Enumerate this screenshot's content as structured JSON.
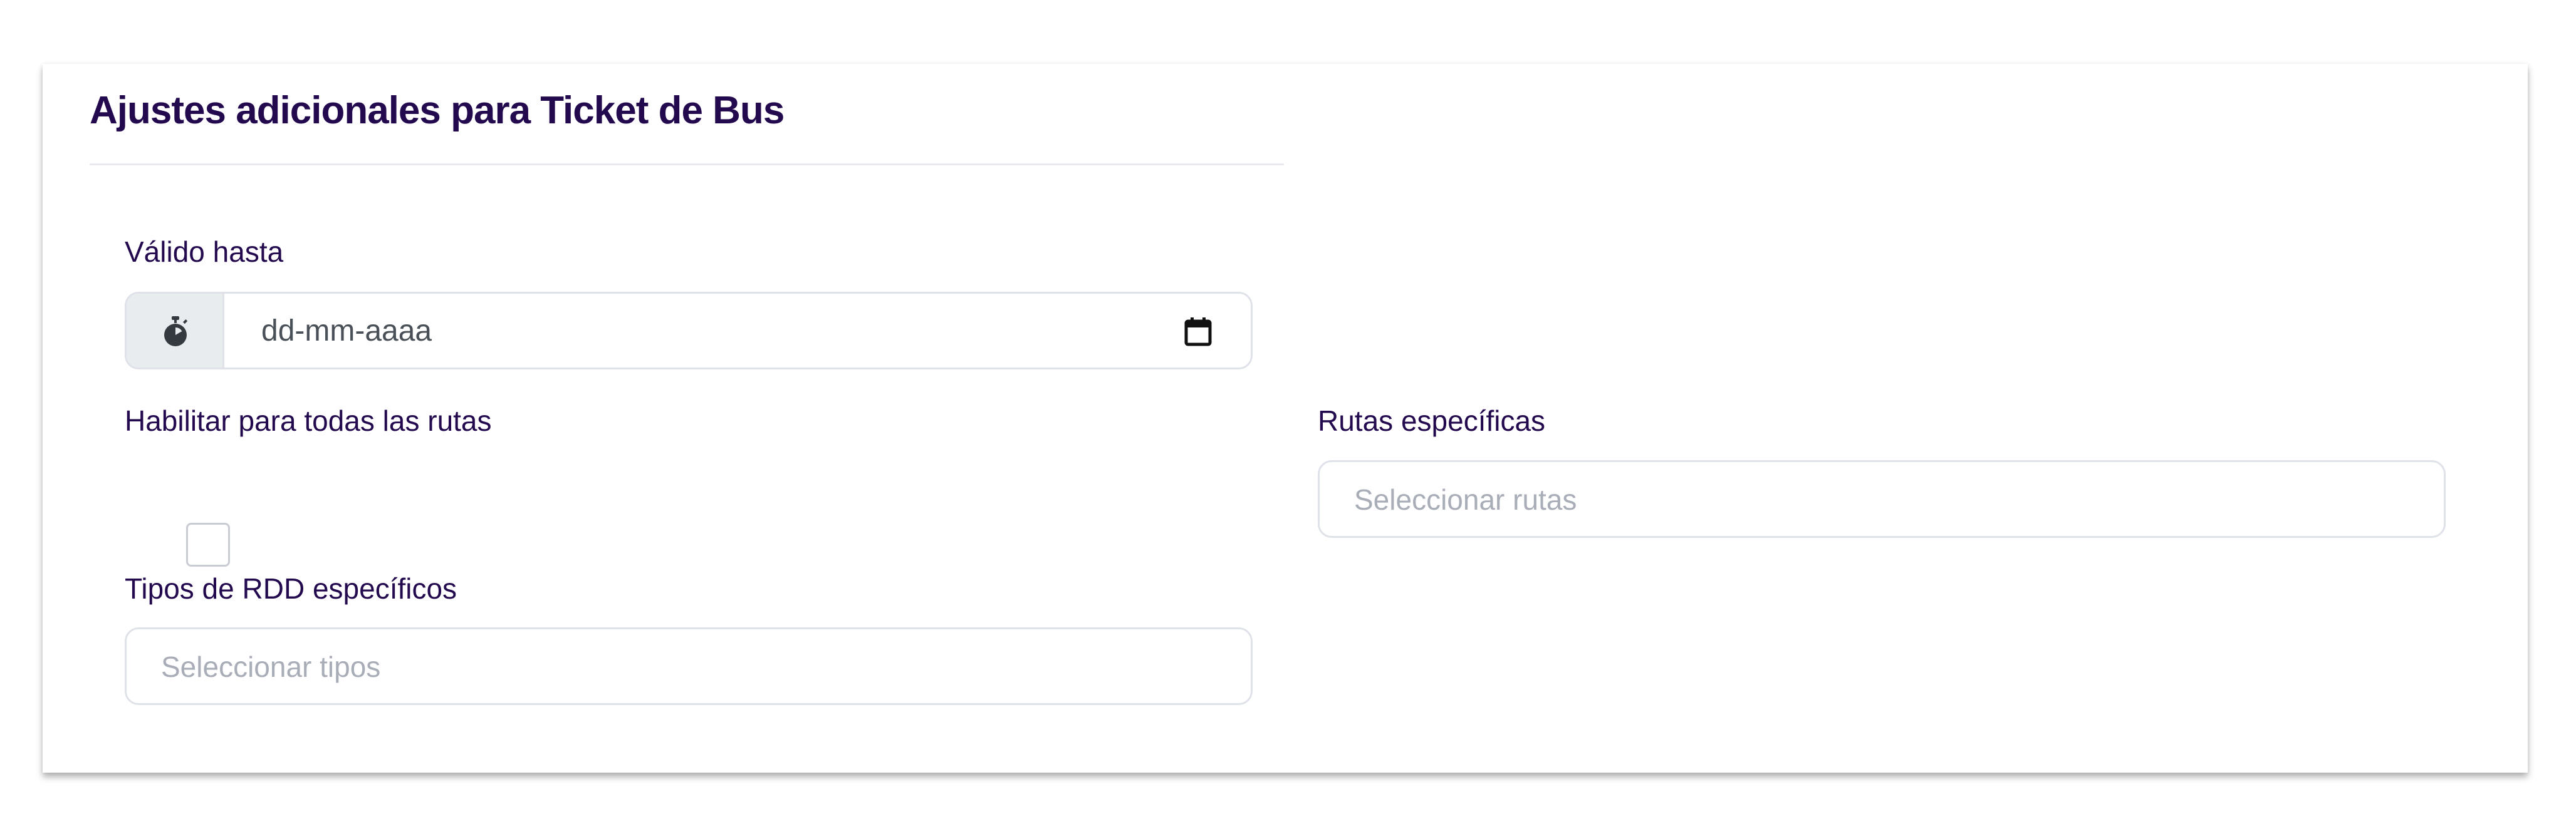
{
  "section": {
    "title": "Ajustes adicionales para Ticket de Bus"
  },
  "valid_until": {
    "label": "Válido hasta",
    "placeholder": "dd-mm-aaaa",
    "addon_icon": "stopwatch-icon",
    "picker_icon": "calendar-icon"
  },
  "all_routes": {
    "label": "Habilitar para todas las rutas",
    "checked": false
  },
  "specific_routes": {
    "label": "Rutas específicas",
    "placeholder": "Seleccionar rutas"
  },
  "rdd_types": {
    "label": "Tipos de RDD específicos",
    "placeholder": "Seleccionar tipos"
  },
  "colors": {
    "heading": "#230a4f",
    "placeholder": "#a8adb7",
    "border": "#dfe2e8",
    "addon_bg": "#e9ecef"
  }
}
